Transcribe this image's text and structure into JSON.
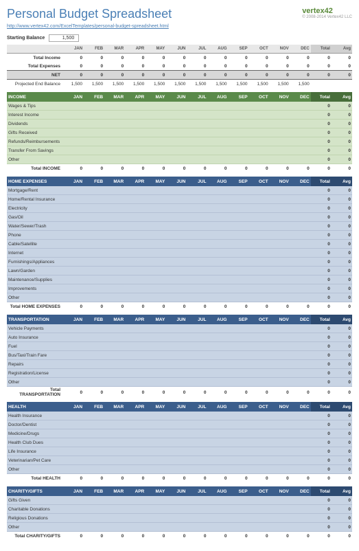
{
  "header": {
    "title": "Personal Budget Spreadsheet",
    "url": "http://www.vertex42.com/ExcelTemplates/personal-budget-spreadsheet.html",
    "logo": "vertex42",
    "copyright": "© 2008-2014 Vertex42 LLC"
  },
  "starting": {
    "label": "Starting Balance",
    "value": "1,500"
  },
  "months": [
    "JAN",
    "FEB",
    "MAR",
    "APR",
    "MAY",
    "JUN",
    "JUL",
    "AUG",
    "SEP",
    "OCT",
    "NOV",
    "DEC"
  ],
  "totals": {
    "total": "Total",
    "avg": "Avg"
  },
  "summary": {
    "income": {
      "label": "Total Income",
      "months": [
        "0",
        "0",
        "0",
        "0",
        "0",
        "0",
        "0",
        "0",
        "0",
        "0",
        "0",
        "0"
      ],
      "total": "0",
      "avg": "0"
    },
    "expenses": {
      "label": "Total Expenses",
      "months": [
        "0",
        "0",
        "0",
        "0",
        "0",
        "0",
        "0",
        "0",
        "0",
        "0",
        "0",
        "0"
      ],
      "total": "0",
      "avg": "0"
    },
    "net": {
      "label": "NET",
      "months": [
        "0",
        "0",
        "0",
        "0",
        "0",
        "0",
        "0",
        "0",
        "0",
        "0",
        "0",
        "0"
      ],
      "total": "0",
      "avg": "0"
    },
    "projected": {
      "label": "Projected End Balance",
      "months": [
        "1,500",
        "1,500",
        "1,500",
        "1,500",
        "1,500",
        "1,500",
        "1,500",
        "1,500",
        "1,500",
        "1,500",
        "1,500",
        "1,500"
      ]
    }
  },
  "sections": [
    {
      "name": "INCOME",
      "style": "g",
      "rows": [
        "Wages & Tips",
        "Interest Income",
        "Dividends",
        "Gifts Received",
        "Refunds/Reimbursements",
        "Transfer From Savings",
        "Other"
      ],
      "totalLabel": "Total INCOME"
    },
    {
      "name": "HOME EXPENSES",
      "style": "b",
      "rows": [
        "Mortgage/Rent",
        "Home/Rental Insurance",
        "Electricity",
        "Gas/Oil",
        "Water/Sewer/Trash",
        "Phone",
        "Cable/Satellite",
        "Internet",
        "Furnishings/Appliances",
        "Lawn/Garden",
        "Maintenance/Supplies",
        "Improvements",
        "Other"
      ],
      "totalLabel": "Total HOME EXPENSES"
    },
    {
      "name": "TRANSPORTATION",
      "style": "b",
      "rows": [
        "Vehicle Payments",
        "Auto Insurance",
        "Fuel",
        "Bus/Taxi/Train Fare",
        "Repairs",
        "Registration/License",
        "Other"
      ],
      "totalLabel": "Total TRANSPORTATION"
    },
    {
      "name": "HEALTH",
      "style": "b",
      "rows": [
        "Health Insurance",
        "Doctor/Dentist",
        "Medicine/Drugs",
        "Health Club Dues",
        "Life Insurance",
        "Veterinarian/Pet Care",
        "Other"
      ],
      "totalLabel": "Total HEALTH"
    },
    {
      "name": "CHARITY/GIFTS",
      "style": "b",
      "rows": [
        "Gifts Given",
        "Charitable Donations",
        "Religious Donations",
        "Other"
      ],
      "totalLabel": "Total CHARITY/GIFTS"
    }
  ]
}
